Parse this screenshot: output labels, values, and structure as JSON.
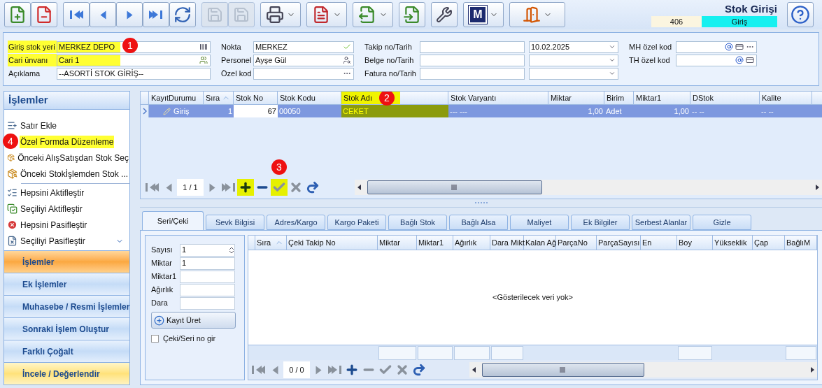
{
  "toolbar": {
    "buttons": [
      {
        "kind": "new",
        "disabled": false,
        "menu": false
      },
      {
        "kind": "delete",
        "disabled": false,
        "menu": false
      },
      {
        "kind": "first",
        "disabled": false,
        "menu": false
      },
      {
        "kind": "prev",
        "disabled": false,
        "menu": false
      },
      {
        "kind": "next",
        "disabled": false,
        "menu": false
      },
      {
        "kind": "last",
        "disabled": false,
        "menu": false
      },
      {
        "kind": "refresh",
        "disabled": false,
        "menu": false
      },
      {
        "kind": "save",
        "disabled": true,
        "menu": false
      },
      {
        "kind": "save-close",
        "disabled": true,
        "menu": false
      },
      {
        "kind": "print",
        "disabled": false,
        "menu": true
      },
      {
        "kind": "pdf",
        "disabled": false,
        "menu": true
      },
      {
        "kind": "export",
        "disabled": false,
        "menu": true
      },
      {
        "kind": "import",
        "disabled": false,
        "menu": false
      },
      {
        "kind": "tools",
        "disabled": false,
        "menu": false
      },
      {
        "kind": "letter",
        "text": "M",
        "disabled": false,
        "menu": true
      },
      {
        "kind": "exit",
        "disabled": false,
        "menu": true
      }
    ]
  },
  "document": {
    "title": "Stok Girişi",
    "number": "406",
    "status": "Giriş"
  },
  "header": {
    "columns": [
      [
        {
          "label": "Giriş stok yeri",
          "value": "MERKEZ DEPO",
          "kind": "barcode",
          "highlighted": true,
          "marker": "1"
        },
        {
          "label": "Cari ünvanı",
          "value": "Cari 1",
          "kind": "people",
          "highlighted": true
        },
        {
          "label": "Açıklama",
          "value": "--ASORTİ STOK GİRİŞ--",
          "kind": "plain",
          "highlighted": false
        }
      ],
      [
        {
          "label": "Nokta",
          "value": "MERKEZ",
          "kind": "check",
          "highlighted": false
        },
        {
          "label": "Personel",
          "value": "Ayşe Gül",
          "kind": "lookup",
          "highlighted": false
        },
        {
          "label": "Özel kod",
          "kind": "ellipsis",
          "highlighted": false
        }
      ],
      [
        {
          "label": "Takip no/Tarih",
          "date": "10.02.2025",
          "kind": "dated",
          "highlighted": false
        },
        {
          "label": "Belge no/Tarih",
          "kind": "dated",
          "highlighted": false
        },
        {
          "label": "Fatura no/Tarih",
          "kind": "dated",
          "highlighted": false
        }
      ],
      [
        {
          "label": "MH özel kod",
          "kind": "code-more",
          "highlighted": false
        },
        {
          "label": "TH özel kod",
          "kind": "code",
          "highlighted": false
        }
      ]
    ]
  },
  "side_panel": {
    "title": "İşlemler",
    "groups": [
      [
        {
          "label": "Satır Ekle",
          "kind": "add",
          "highlighted": false
        },
        {
          "label": "Özel Formda Düzenleme",
          "highlighted": true,
          "marker": "4"
        },
        {
          "label": "Önceki AlışSatışdan Stok Seç",
          "kind": "pick",
          "highlighted": false
        },
        {
          "label": "Önceki Stokİşlemden Stok ...",
          "kind": "pick",
          "highlighted": false
        }
      ],
      [
        {
          "label": "Hepsini Aktifleştir",
          "kind": "all",
          "highlighted": false
        },
        {
          "label": "Seçiliyi Aktifleştir",
          "kind": "one",
          "highlighted": false
        },
        {
          "label": "Hepsini Pasifleştir",
          "kind": "off",
          "highlighted": false
        },
        {
          "label": "Seçiliyi Pasifleştir",
          "kind": "drop",
          "highlighted": false
        }
      ]
    ],
    "sections": [
      {
        "label": "İşlemler",
        "selected": true
      },
      {
        "label": "Ek İşlemler",
        "selected": false
      },
      {
        "label": "Muhasebe / Resmi İşlemler",
        "selected": false
      },
      {
        "label": "Sonraki İşlem Oluştur",
        "selected": false
      },
      {
        "label": "Farklı Çoğalt",
        "selected": false
      },
      {
        "label": "İncele / Değerlendir",
        "selected": false,
        "hovered": true
      }
    ]
  },
  "grid": {
    "columns": [
      {
        "label": "KayıtDurumu",
        "highlighted": false,
        "focused": false
      },
      {
        "label": "Sıra",
        "sorted": true,
        "highlighted": false,
        "focused": false
      },
      {
        "label": "Stok No",
        "highlighted": false,
        "focused": true
      },
      {
        "label": "Stok Kodu",
        "highlighted": false,
        "focused": false
      },
      {
        "label": "Stok Adı",
        "highlighted": true,
        "marker": "2"
      },
      {
        "label": "Stok Varyantı",
        "highlighted": false,
        "focused": false
      },
      {
        "label": "Miktar",
        "highlighted": false,
        "focused": false
      },
      {
        "label": "Birim",
        "highlighted": false,
        "focused": false
      },
      {
        "label": "Miktar1",
        "highlighted": false,
        "focused": false
      },
      {
        "label": "DStok",
        "highlighted": false,
        "focused": false
      },
      {
        "label": "Kalite",
        "highlighted": false,
        "focused": false
      }
    ],
    "rows": [
      {
        "selected": true,
        "cells": [
          "Giriş",
          "1",
          "67",
          "00050",
          "CEKET",
          "--- ---",
          "1,00",
          "Adet",
          "1,00",
          "-- --",
          "-- --"
        ]
      }
    ],
    "navigator": {
      "position": "1 / 1",
      "buttons": [
        {
          "kind": "first",
          "disabled": true,
          "highlighted": false
        },
        {
          "kind": "prev",
          "disabled": true,
          "highlighted": false
        },
        {
          "kind": "next",
          "disabled": true,
          "highlighted": false
        },
        {
          "kind": "last",
          "disabled": true,
          "highlighted": false
        },
        {
          "kind": "append",
          "disabled": false,
          "highlighted": true
        },
        {
          "kind": "remove",
          "disabled": false,
          "highlighted": false
        },
        {
          "kind": "post",
          "disabled": true,
          "highlighted": true,
          "marker": "3"
        },
        {
          "kind": "cancel",
          "disabled": true,
          "highlighted": false
        },
        {
          "kind": "refresh",
          "disabled": false,
          "highlighted": false
        }
      ]
    }
  },
  "tabs": [
    {
      "label": "Seri/Çeki",
      "selected": true
    },
    {
      "label": "Sevk Bilgisi",
      "selected": false
    },
    {
      "label": "Adres/Kargo",
      "selected": false
    },
    {
      "label": "Kargo Paketi",
      "selected": false
    },
    {
      "label": "Bağlı Stok",
      "selected": false
    },
    {
      "label": "Bağlı Alsa",
      "selected": false
    },
    {
      "label": "Maliyet",
      "selected": false
    },
    {
      "label": "Ek Bilgiler",
      "selected": false
    },
    {
      "label": "Serbest Alanlar",
      "selected": false
    },
    {
      "label": "Gizle",
      "selected": false
    }
  ],
  "serial_form": {
    "fields": [
      {
        "label": "Sayısı",
        "value": "1",
        "kind": "spin"
      },
      {
        "label": "Miktar",
        "value": "1",
        "kind": "text"
      },
      {
        "label": "Miktar1",
        "kind": "text"
      },
      {
        "label": "Ağırlık",
        "kind": "text"
      },
      {
        "label": "Dara",
        "kind": "text"
      }
    ],
    "button": "Kayıt Üret",
    "checkbox": {
      "label": "Çeki/Seri no gir",
      "checked": false
    }
  },
  "serial_grid": {
    "columns": [
      {
        "label": "Sıra",
        "sorted": true,
        "summary": false
      },
      {
        "label": "Çeki Takip No",
        "summary": false
      },
      {
        "label": "Miktar",
        "summary": true
      },
      {
        "label": "Miktar1",
        "summary": true
      },
      {
        "label": "Ağırlık",
        "summary": true
      },
      {
        "label": "Dara Mikt",
        "summary": true
      },
      {
        "label": "Kalan Ağ",
        "summary": false
      },
      {
        "label": "ParçaNo",
        "summary": false
      },
      {
        "label": "ParçaSayısı",
        "summary": false
      },
      {
        "label": "En",
        "summary": false
      },
      {
        "label": "Boy",
        "summary": true
      },
      {
        "label": "Yükseklik",
        "summary": false
      },
      {
        "label": "Çap",
        "summary": false
      },
      {
        "label": "BağlıM",
        "summary": true
      }
    ],
    "empty_text": "<Gösterilecek veri yok>",
    "navigator": {
      "position": "0 / 0",
      "buttons": [
        {
          "kind": "first",
          "disabled": true,
          "highlighted": false
        },
        {
          "kind": "prev",
          "disabled": true,
          "highlighted": false
        },
        {
          "kind": "next",
          "disabled": true,
          "highlighted": false
        },
        {
          "kind": "last",
          "disabled": true,
          "highlighted": false
        },
        {
          "kind": "append",
          "disabled": false,
          "highlighted": false
        },
        {
          "kind": "remove",
          "disabled": true,
          "highlighted": false
        },
        {
          "kind": "post",
          "disabled": true,
          "highlighted": false
        },
        {
          "kind": "cancel",
          "disabled": true,
          "highlighted": false
        },
        {
          "kind": "refresh",
          "disabled": false,
          "highlighted": false
        }
      ]
    }
  }
}
